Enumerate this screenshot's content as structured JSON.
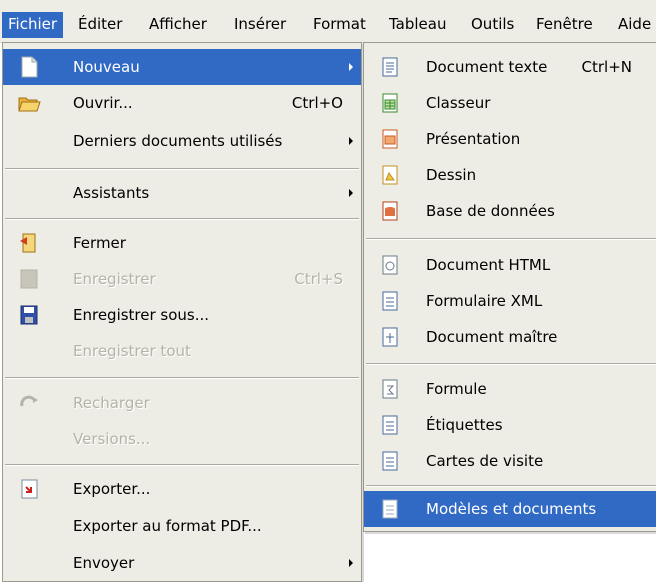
{
  "menubar": {
    "items": [
      {
        "label": "Fichier"
      },
      {
        "label": "Éditer"
      },
      {
        "label": "Afficher"
      },
      {
        "label": "Insérer"
      },
      {
        "label": "Format"
      },
      {
        "label": "Tableau"
      },
      {
        "label": "Outils"
      },
      {
        "label": "Fenêtre"
      },
      {
        "label": "Aide"
      }
    ]
  },
  "file_menu": {
    "items": [
      {
        "label": "Nouveau",
        "icon": "new-document-icon"
      },
      {
        "label": "Ouvrir...",
        "shortcut": "Ctrl+O",
        "icon": "open-folder-icon"
      },
      {
        "label": "Derniers documents utilisés"
      },
      {
        "label": "Assistants"
      },
      {
        "label": "Fermer",
        "icon": "close-document-icon"
      },
      {
        "label": "Enregistrer",
        "shortcut": "Ctrl+S",
        "icon": "save-icon"
      },
      {
        "label": "Enregistrer sous...",
        "icon": "save-as-icon"
      },
      {
        "label": "Enregistrer tout"
      },
      {
        "label": "Recharger",
        "icon": "reload-icon"
      },
      {
        "label": "Versions..."
      },
      {
        "label": "Exporter...",
        "icon": "export-icon"
      },
      {
        "label": "Exporter au format PDF..."
      },
      {
        "label": "Envoyer"
      }
    ]
  },
  "new_submenu": {
    "items": [
      {
        "label": "Document texte",
        "shortcut": "Ctrl+N",
        "icon": "text-document-icon"
      },
      {
        "label": "Classeur",
        "icon": "spreadsheet-icon"
      },
      {
        "label": "Présentation",
        "icon": "presentation-icon"
      },
      {
        "label": "Dessin",
        "icon": "drawing-icon"
      },
      {
        "label": "Base de données",
        "icon": "database-icon"
      },
      {
        "label": "Document HTML",
        "icon": "html-document-icon"
      },
      {
        "label": "Formulaire XML",
        "icon": "xml-form-icon"
      },
      {
        "label": "Document maître",
        "icon": "master-document-icon"
      },
      {
        "label": "Formule",
        "icon": "formula-icon"
      },
      {
        "label": "Étiquettes",
        "icon": "labels-icon"
      },
      {
        "label": "Cartes de visite",
        "icon": "business-cards-icon"
      },
      {
        "label": "Modèles et documents",
        "icon": "templates-icon"
      }
    ]
  },
  "colors": {
    "menu_background": "#eeede5",
    "selection": "#316ac5",
    "disabled_text": "#b5b4a7"
  }
}
